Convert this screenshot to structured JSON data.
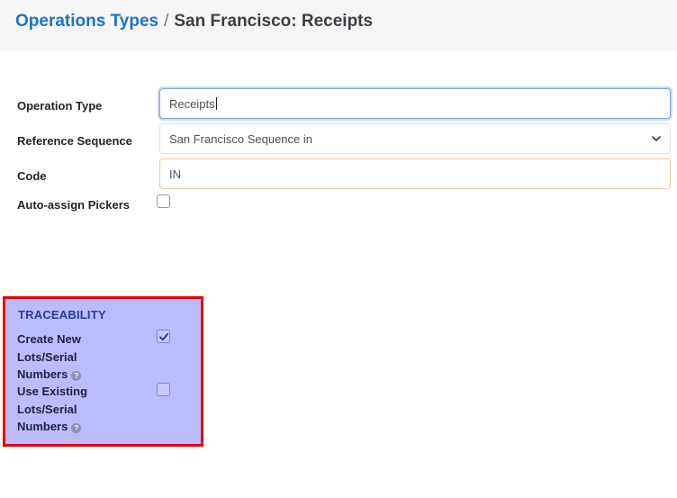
{
  "breadcrumb": {
    "parent": "Operations Types",
    "separator": "/",
    "current": "San Francisco: Receipts"
  },
  "form": {
    "operation_type": {
      "label": "Operation Type",
      "value": "Receipts"
    },
    "reference_sequence": {
      "label": "Reference Sequence",
      "value": "San Francisco Sequence in"
    },
    "code": {
      "label": "Code",
      "value": "IN"
    },
    "auto_assign": {
      "label": "Auto-assign Pickers",
      "checked": false
    }
  },
  "traceability": {
    "title": "TRACEABILITY",
    "create_new": {
      "label_line1": "Create New",
      "label_line2": "Lots/Serial",
      "label_line3": "Numbers",
      "help": "?",
      "checked": true
    },
    "use_existing": {
      "label_line1": "Use Existing",
      "label_line2": "Lots/Serial",
      "label_line3": "Numbers",
      "help": "?",
      "checked": false
    }
  },
  "colors": {
    "link": "#1a73c9",
    "highlight_bg": "#babcff",
    "highlight_border": "#e8000b",
    "focus_border": "#7aa6e6"
  }
}
